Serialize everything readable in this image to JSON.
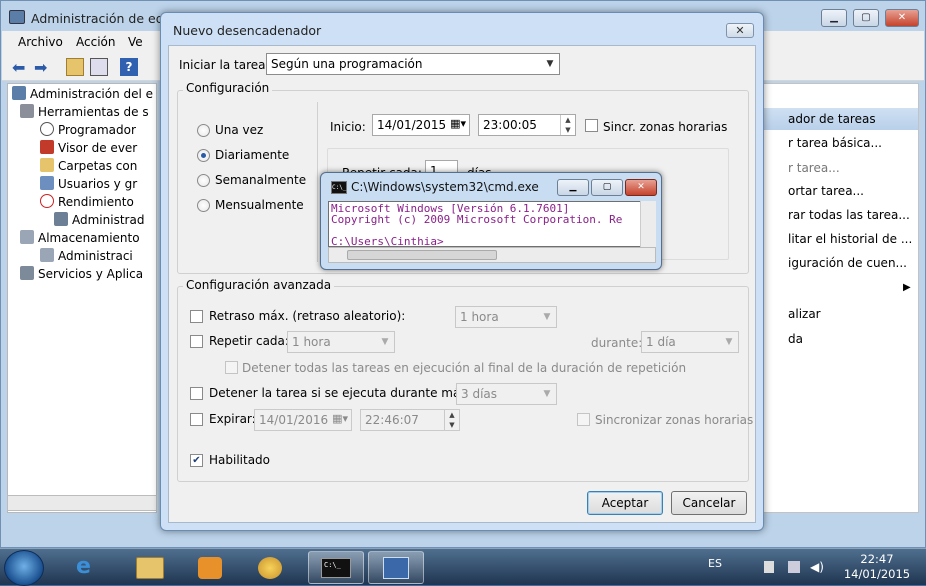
{
  "bg_window": {
    "title": "Administración de equip",
    "menu": [
      "Archivo",
      "Acción",
      "Ve"
    ],
    "tree": [
      "Administración del e",
      "Herramientas de s",
      "Programador",
      "Visor de ever",
      "Carpetas con",
      "Usuarios y gr",
      "Rendimiento",
      "Administrad",
      "Almacenamiento",
      "Administraci",
      "Servicios y Aplica"
    ],
    "actions_header": "ador de tareas",
    "actions": [
      "r tarea básica...",
      "r tarea...",
      "ortar tarea...",
      "rar todas las tarea...",
      "litar el historial de ...",
      "iguración de cuen...",
      "alizar",
      "da"
    ]
  },
  "dialog": {
    "title": "Nuevo desencadenador",
    "close_symbol": "✕",
    "start_task_label": "Iniciar la tarea:",
    "start_task_value": "Según una programación",
    "config_label": "Configuración",
    "radios": [
      "Una vez",
      "Diariamente",
      "Semanalmente",
      "Mensualmente"
    ],
    "start_label": "Inicio:",
    "start_date": "14/01/2015",
    "start_time": "23:00:05",
    "sync_tz_label": "Sincr. zonas horarias",
    "repeat_every_label": "Repetir cada:",
    "repeat_every_value": "1",
    "days_label": "días",
    "advanced_label": "Configuración avanzada",
    "delay_label": "Retraso máx. (retraso aleatorio):",
    "delay_value": "1 hora",
    "repeat_task_label": "Repetir cada:",
    "repeat_task_value": "1 hora",
    "duration_label": "durante:",
    "duration_value": "1 día",
    "stop_all_label": "Detener todas las tareas en ejecución al final de la duración de repetición",
    "stop_if_label": "Detener la tarea si se ejecuta durante más de:",
    "stop_if_value": "3 días",
    "expire_label": "Expirar:",
    "expire_date": "14/01/2016",
    "expire_time": "22:46:07",
    "sync_zones_label": "Sincronizar zonas horarias",
    "enabled_label": "Habilitado",
    "ok_label": "Aceptar",
    "cancel_label": "Cancelar"
  },
  "cmd": {
    "title": "C:\\Windows\\system32\\cmd.exe",
    "icon_text": "C:\\_",
    "lines": [
      "Microsoft Windows [Versión 6.1.7601]",
      "Copyright (c) 2009 Microsoft Corporation. Re",
      "",
      "C:\\Users\\Cinthia>_"
    ]
  },
  "taskbar": {
    "lang": "ES",
    "time": "22:47",
    "date": "14/01/2015"
  },
  "colors": {
    "dialog_frame": "#cde0f5",
    "accent": "#2a5aa8",
    "cmd_text": "#8a1f8a",
    "taskbar": "#1f3550"
  }
}
